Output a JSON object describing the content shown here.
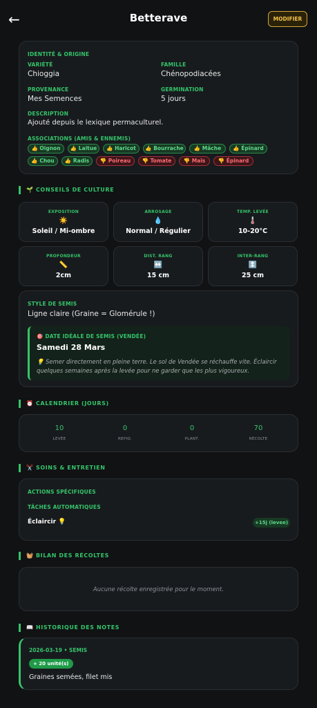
{
  "header": {
    "back_icon": "←",
    "title": "Betterave",
    "modify_label": "MODIFIER"
  },
  "identity": {
    "section_label": "IDENTITÉ & ORIGINE",
    "variety_label": "VARIÉTÉ",
    "variety_value": "Chioggia",
    "family_label": "FAMILLE",
    "family_value": "Chénopodiacées",
    "origin_label": "PROVENANCE",
    "origin_value": "Mes Semences",
    "germination_label": "GERMINATION",
    "germination_value": "5 jours",
    "description_label": "DESCRIPTION",
    "description_value": "Ajouté depuis le lexique permaculturel.",
    "associations_label": "ASSOCIATIONS (AMIS & ENNEMIS)",
    "associations": [
      {
        "icon": "👍",
        "label": "Oignon",
        "type": "good"
      },
      {
        "icon": "👍",
        "label": "Laitue",
        "type": "good"
      },
      {
        "icon": "👍",
        "label": "Haricot",
        "type": "good"
      },
      {
        "icon": "👍",
        "label": "Bourrache",
        "type": "good"
      },
      {
        "icon": "👍",
        "label": "Mâche",
        "type": "good"
      },
      {
        "icon": "👍",
        "label": "Épinard",
        "type": "good"
      },
      {
        "icon": "👍",
        "label": "Chou",
        "type": "good"
      },
      {
        "icon": "👍",
        "label": "Radis",
        "type": "good"
      },
      {
        "icon": "👎",
        "label": "Poireau",
        "type": "bad"
      },
      {
        "icon": "👎",
        "label": "Tomate",
        "type": "bad"
      },
      {
        "icon": "👎",
        "label": "Maïs",
        "type": "bad"
      },
      {
        "icon": "👎",
        "label": "Épinard",
        "type": "bad"
      }
    ]
  },
  "culture": {
    "section_icon": "🌱",
    "section_title": "CONSEILS DE CULTURE",
    "tiles": [
      {
        "label": "EXPOSITION",
        "icon": "☀️",
        "value": "Soleil / Mi-ombre"
      },
      {
        "label": "ARROSAGE",
        "icon": "💧",
        "value": "Normal / Régulier"
      },
      {
        "label": "TEMP. LEVÉE",
        "icon": "🌡️",
        "value": "10-20°C"
      },
      {
        "label": "PROFONDEUR",
        "icon": "📏",
        "value": "2cm"
      },
      {
        "label": "DIST. RANG",
        "icon": "↔️",
        "value": "15 cm"
      },
      {
        "label": "INTER-RANG",
        "icon": "↕️",
        "value": "25 cm"
      }
    ],
    "sowing_style_label": "STYLE DE SEMIS",
    "sowing_style_value": "Ligne claire (Graine = Glomérule !)",
    "ideal_date_icon": "🎯",
    "ideal_date_label": "DATE IDÉALE DE SEMIS (VENDÉE)",
    "ideal_date_value": "Samedi 28 Mars",
    "tip_icon": "💡",
    "tip_text": "Semer directement en pleine terre. Le sol de Vendée se réchauffe vite. Éclaircir quelques semaines après la levée pour ne garder que les plus vigoureux."
  },
  "calendar": {
    "section_icon": "⏰",
    "section_title": "CALENDRIER (JOURS)",
    "items": [
      {
        "value": "10",
        "label": "LEVÉE"
      },
      {
        "value": "0",
        "label": "REPIQ."
      },
      {
        "value": "0",
        "label": "PLANT."
      },
      {
        "value": "70",
        "label": "RÉCOLTE"
      }
    ]
  },
  "care": {
    "section_icon": "✂️",
    "section_title": "SOINS & ENTRETIEN",
    "specific_label": "ACTIONS SPÉCIFIQUES",
    "auto_label": "TÂCHES AUTOMATIQUES",
    "task_name": "Éclaircir",
    "task_icon": "💡",
    "task_badge": "+15j (levee)"
  },
  "harvest": {
    "section_icon": "🧺",
    "section_title": "BILAN DES RÉCOLTES",
    "empty_text": "Aucune récolte enregistrée pour le moment."
  },
  "notes": {
    "section_icon": "📖",
    "section_title": "HISTORIQUE DES NOTES",
    "entries": [
      {
        "date": "2026-03-19 • SEMIS",
        "badge": "+ 20 unité(s)",
        "text": "Graines semées, filet mis"
      }
    ]
  }
}
